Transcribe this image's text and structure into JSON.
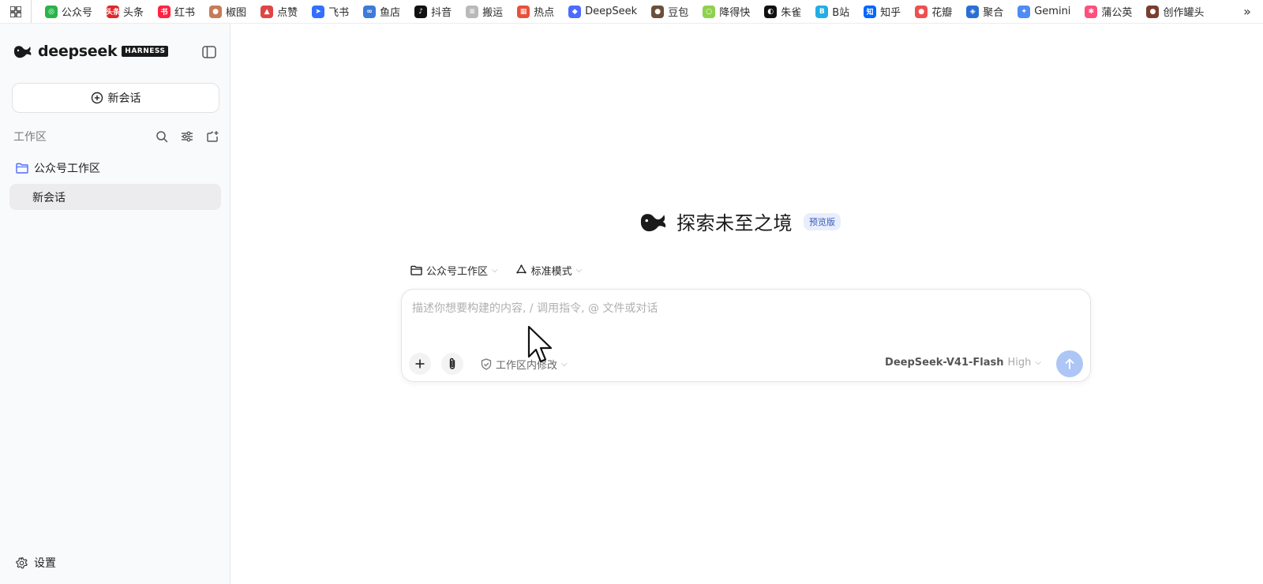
{
  "bookmarks": {
    "items": [
      {
        "label": "公众号",
        "color": "#2bb24c",
        "glyph": "◎"
      },
      {
        "label": "头条",
        "color": "#e02828",
        "glyph": "头条"
      },
      {
        "label": "红书",
        "color": "#ff2442",
        "glyph": "书"
      },
      {
        "label": "椒图",
        "color": "#c77b57",
        "glyph": "●"
      },
      {
        "label": "点赞",
        "color": "#e04545",
        "glyph": "▲"
      },
      {
        "label": "飞书",
        "color": "#3370ff",
        "glyph": "➤"
      },
      {
        "label": "鱼店",
        "color": "#3d7bd9",
        "glyph": "∞"
      },
      {
        "label": "抖音",
        "color": "#111111",
        "glyph": "♪"
      },
      {
        "label": "搬运",
        "color": "#b9b9b9",
        "glyph": "≡"
      },
      {
        "label": "热点",
        "color": "#e8503a",
        "glyph": "▦"
      },
      {
        "label": "DeepSeek",
        "color": "#4d6bfe",
        "glyph": "◆"
      },
      {
        "label": "豆包",
        "color": "#6b4f3a",
        "glyph": "●"
      },
      {
        "label": "降得快",
        "color": "#8fd14f",
        "glyph": "○"
      },
      {
        "label": "朱雀",
        "color": "#111111",
        "glyph": "◐"
      },
      {
        "label": "B站",
        "color": "#23ade5",
        "glyph": "B"
      },
      {
        "label": "知乎",
        "color": "#0066ff",
        "glyph": "知"
      },
      {
        "label": "花瓣",
        "color": "#ee5050",
        "glyph": "●"
      },
      {
        "label": "聚合",
        "color": "#2b6fd6",
        "glyph": "◈"
      },
      {
        "label": "Gemini",
        "color": "#4f8bf6",
        "glyph": "✦"
      },
      {
        "label": "蒲公英",
        "color": "#ff4f7e",
        "glyph": "✱"
      },
      {
        "label": "创作罐头",
        "color": "#7a3e2e",
        "glyph": "●"
      }
    ],
    "more_glyph": "»"
  },
  "sidebar": {
    "brand_name": "deepseek",
    "brand_tag": "HARNESS",
    "new_chat_label": "新会话",
    "workspace_title": "工作区",
    "folder_label": "公众号工作区",
    "chat_item_label": "新会话",
    "settings_label": "设置"
  },
  "main": {
    "hero_title": "探索未至之境",
    "hero_badge": "预览版",
    "workspace_selector": "公众号工作区",
    "mode_selector": "标准模式",
    "input_placeholder": "描述你想要构建的内容, / 调用指令, @ 文件或对话",
    "permission_label": "工作区内修改",
    "model_name": "DeepSeek-V41-Flash",
    "model_level": "High"
  },
  "colors": {
    "accent": "#4d6bfe",
    "send_button": "#aec6f6",
    "sidebar_bg": "#f9fafb",
    "selected_item_bg": "#ececee"
  }
}
